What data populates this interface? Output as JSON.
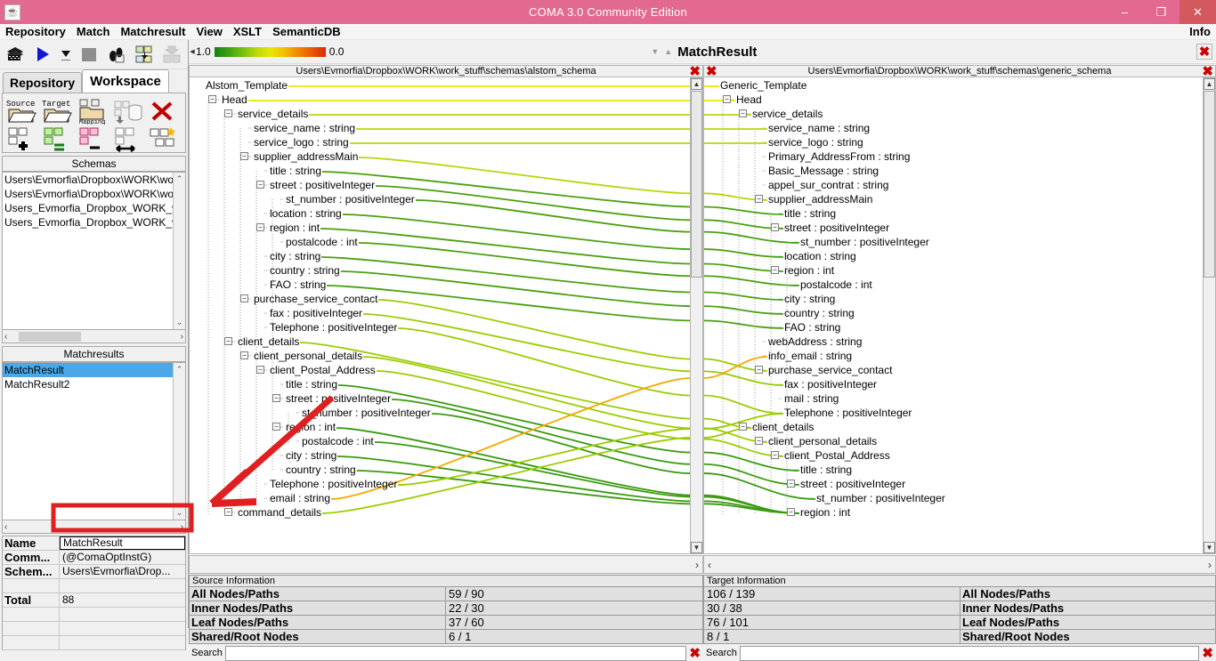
{
  "window": {
    "title": "COMA 3.0 Community Edition",
    "app_icon": "java-icon",
    "minimize": "–",
    "maximize": "❐",
    "close": "✕"
  },
  "menubar": {
    "items": [
      "Repository",
      "Match",
      "Matchresult",
      "View",
      "XSLT",
      "SemanticDB"
    ],
    "right_item": "Info"
  },
  "toolbar": {
    "icons": [
      "repository-icon",
      "run-match-icon",
      "dropdown-arrow-icon",
      "stop-icon",
      "footprint-icon",
      "import-schema-icon",
      "export-icon"
    ]
  },
  "tabs": {
    "items": [
      {
        "label": "Repository",
        "active": false
      },
      {
        "label": "Workspace",
        "active": true
      }
    ]
  },
  "workspace_tools": {
    "row1": [
      "source-folder-icon",
      "target-folder-icon",
      "mapping-folder-icon",
      "schema-to-db-icon",
      "delete-red-x-icon"
    ],
    "row1_labels": [
      "Source",
      "Target",
      "Mapping"
    ],
    "row2": [
      "add-schema-icon",
      "match-equal-icon",
      "diff-schema-icon",
      "compare-schemas-icon",
      "new-mapping-icon"
    ]
  },
  "schemas_panel": {
    "title": "Schemas",
    "items": [
      "Users\\Evmorfia\\Dropbox\\WORK\\work_",
      "Users\\Evmorfia\\Dropbox\\WORK\\work_",
      "Users_Evmorfia_Dropbox_WORK_wor",
      "Users_Evmorfia_Dropbox_WORK_wor"
    ],
    "scroll_up": "⌃",
    "scroll_down": "⌄",
    "h_left": "‹",
    "h_right": "›"
  },
  "matchresults_panel": {
    "title": "Matchresults",
    "items": [
      {
        "label": "MatchResult",
        "selected": true
      },
      {
        "label": "MatchResult2",
        "selected": false
      }
    ],
    "scroll_up": "⌃",
    "scroll_down": "⌄",
    "h_left": "‹",
    "h_right": "›"
  },
  "properties": {
    "rows": [
      {
        "key": "Name",
        "value": "MatchResult",
        "editing": true
      },
      {
        "key": "Comm...",
        "value": "(@ComaOptInstG)",
        "editing": false
      },
      {
        "key": "Schem...",
        "value": "Users\\Evmorfia\\Drop...",
        "editing": false
      },
      {
        "key": "",
        "value": "",
        "editing": false
      },
      {
        "key": "Total",
        "value": "88",
        "editing": false
      },
      {
        "key": "",
        "value": "",
        "editing": false
      },
      {
        "key": "",
        "value": "",
        "editing": false
      },
      {
        "key": "",
        "value": "",
        "editing": false
      }
    ]
  },
  "gradient": {
    "max_label": "1.0",
    "min_label": "0.0",
    "left_arrow": "◀",
    "right_arrow": "▶"
  },
  "matchresult_header": {
    "down_triangle": "▼",
    "up_triangle": "▲",
    "label": "MatchResult",
    "close": "✖"
  },
  "source_pane": {
    "path": "Users\\Evmorfia\\Dropbox\\WORK\\work_stuff\\schemas\\alstom_schema",
    "close_icon": "✖",
    "foot_left": "",
    "foot_right": "›",
    "scroll_up": "▲",
    "scroll_down": "▼",
    "nodes": [
      {
        "label": "Alstom_Template",
        "depth": 0,
        "expander": "none"
      },
      {
        "label": "Head",
        "depth": 1,
        "expander": "minus"
      },
      {
        "label": "service_details",
        "depth": 2,
        "expander": "minus"
      },
      {
        "label": "service_name : string",
        "depth": 3,
        "expander": "leaf"
      },
      {
        "label": "service_logo : string",
        "depth": 3,
        "expander": "leaf"
      },
      {
        "label": "supplier_addressMain",
        "depth": 3,
        "expander": "minus"
      },
      {
        "label": "title : string",
        "depth": 4,
        "expander": "leaf"
      },
      {
        "label": "street : positiveInteger",
        "depth": 4,
        "expander": "minus"
      },
      {
        "label": "st_number : positiveInteger",
        "depth": 5,
        "expander": "leaf"
      },
      {
        "label": "location : string",
        "depth": 4,
        "expander": "leaf"
      },
      {
        "label": "region : int",
        "depth": 4,
        "expander": "minus"
      },
      {
        "label": "postalcode : int",
        "depth": 5,
        "expander": "leaf"
      },
      {
        "label": "city : string",
        "depth": 4,
        "expander": "leaf"
      },
      {
        "label": "country : string",
        "depth": 4,
        "expander": "leaf"
      },
      {
        "label": "FAO : string",
        "depth": 4,
        "expander": "leaf"
      },
      {
        "label": "purchase_service_contact",
        "depth": 3,
        "expander": "minus"
      },
      {
        "label": "fax : positiveInteger",
        "depth": 4,
        "expander": "leaf"
      },
      {
        "label": "Telephone : positiveInteger",
        "depth": 4,
        "expander": "leaf"
      },
      {
        "label": "client_details",
        "depth": 2,
        "expander": "minus"
      },
      {
        "label": "client_personal_details",
        "depth": 3,
        "expander": "minus"
      },
      {
        "label": "client_Postal_Address",
        "depth": 4,
        "expander": "minus"
      },
      {
        "label": "title : string",
        "depth": 5,
        "expander": "leaf"
      },
      {
        "label": "street : positiveInteger",
        "depth": 5,
        "expander": "minus"
      },
      {
        "label": "st_number : positiveInteger",
        "depth": 6,
        "expander": "leaf"
      },
      {
        "label": "region : int",
        "depth": 5,
        "expander": "minus"
      },
      {
        "label": "postalcode : int",
        "depth": 6,
        "expander": "leaf"
      },
      {
        "label": "city : string",
        "depth": 5,
        "expander": "leaf"
      },
      {
        "label": "country : string",
        "depth": 5,
        "expander": "leaf"
      },
      {
        "label": "Telephone : positiveInteger",
        "depth": 4,
        "expander": "leaf"
      },
      {
        "label": "email : string",
        "depth": 4,
        "expander": "leaf"
      },
      {
        "label": "command_details",
        "depth": 2,
        "expander": "minus"
      }
    ]
  },
  "target_pane": {
    "path": "Users\\Evmorfia\\Dropbox\\WORK\\work_stuff\\schemas\\generic_schema",
    "close_icon": "✖",
    "foot_left": "‹",
    "foot_right": "›",
    "scroll_up": "▲",
    "scroll_down": "▼",
    "nodes": [
      {
        "label": "Generic_Template",
        "depth": 0,
        "expander": "none"
      },
      {
        "label": "Head",
        "depth": 1,
        "expander": "minus"
      },
      {
        "label": "service_details",
        "depth": 2,
        "expander": "minus"
      },
      {
        "label": "service_name : string",
        "depth": 3,
        "expander": "leaf"
      },
      {
        "label": "service_logo : string",
        "depth": 3,
        "expander": "leaf"
      },
      {
        "label": "Primary_AddressFrom : string",
        "depth": 3,
        "expander": "leaf"
      },
      {
        "label": "Basic_Message : string",
        "depth": 3,
        "expander": "leaf"
      },
      {
        "label": "appel_sur_contrat : string",
        "depth": 3,
        "expander": "leaf"
      },
      {
        "label": "supplier_addressMain",
        "depth": 3,
        "expander": "minus"
      },
      {
        "label": "title : string",
        "depth": 4,
        "expander": "leaf"
      },
      {
        "label": "street : positiveInteger",
        "depth": 4,
        "expander": "minus"
      },
      {
        "label": "st_number : positiveInteger",
        "depth": 5,
        "expander": "leaf"
      },
      {
        "label": "location : string",
        "depth": 4,
        "expander": "leaf"
      },
      {
        "label": "region : int",
        "depth": 4,
        "expander": "minus"
      },
      {
        "label": "postalcode : int",
        "depth": 5,
        "expander": "leaf"
      },
      {
        "label": "city : string",
        "depth": 4,
        "expander": "leaf"
      },
      {
        "label": "country : string",
        "depth": 4,
        "expander": "leaf"
      },
      {
        "label": "FAO : string",
        "depth": 4,
        "expander": "leaf"
      },
      {
        "label": "webAddress : string",
        "depth": 3,
        "expander": "leaf"
      },
      {
        "label": "info_email : string",
        "depth": 3,
        "expander": "leaf"
      },
      {
        "label": "purchase_service_contact",
        "depth": 3,
        "expander": "minus"
      },
      {
        "label": "fax : positiveInteger",
        "depth": 4,
        "expander": "leaf"
      },
      {
        "label": "mail : string",
        "depth": 4,
        "expander": "leaf"
      },
      {
        "label": "Telephone : positiveInteger",
        "depth": 4,
        "expander": "leaf"
      },
      {
        "label": "client_details",
        "depth": 2,
        "expander": "minus"
      },
      {
        "label": "client_personal_details",
        "depth": 3,
        "expander": "minus"
      },
      {
        "label": "client_Postal_Address",
        "depth": 4,
        "expander": "minus"
      },
      {
        "label": "title : string",
        "depth": 5,
        "expander": "leaf"
      },
      {
        "label": "street : positiveInteger",
        "depth": 5,
        "expander": "minus"
      },
      {
        "label": "st_number : positiveInteger",
        "depth": 6,
        "expander": "leaf"
      },
      {
        "label": "region : int",
        "depth": 5,
        "expander": "minus"
      }
    ]
  },
  "source_information": {
    "title": "Source Information",
    "rows": [
      {
        "label": "All Nodes/Paths",
        "value": "59 / 90"
      },
      {
        "label": "Inner Nodes/Paths",
        "value": "22 / 30"
      },
      {
        "label": "Leaf Nodes/Paths",
        "value": "37 / 60"
      },
      {
        "label": "Shared/Root Nodes",
        "value": "6 / 1"
      }
    ],
    "search_label": "Search",
    "search_value": "",
    "search_clear": "✖"
  },
  "target_information": {
    "title": "Target Information",
    "rows": [
      {
        "value": "106 / 139",
        "label": "All Nodes/Paths"
      },
      {
        "value": "30 / 38",
        "label": "Inner Nodes/Paths"
      },
      {
        "value": "76 / 101",
        "label": "Leaf Nodes/Paths"
      },
      {
        "value": "8 / 1",
        "label": "Shared/Root Nodes"
      }
    ],
    "search_label": "Search",
    "search_value": "",
    "search_clear": "✖"
  },
  "annotation": {
    "arrow_color": "#e02020",
    "box_color": "#e02020",
    "points_to": "Name field with value MatchResult"
  },
  "colors": {
    "titlebar": "#e2698f",
    "close_button": "#d4595f",
    "selection": "#4aa8e8",
    "panel": "#f0f0f0",
    "mapping_high": "#128012",
    "mapping_mid": "#9acd00",
    "mapping_low": "#f5a800"
  },
  "mapping_links": {
    "description": "curved links between source and target tree nodes colored by similarity",
    "links": [
      {
        "from": 0,
        "to": 0,
        "color": "#e8e800"
      },
      {
        "from": 1,
        "to": 1,
        "color": "#e8e800"
      },
      {
        "from": 2,
        "to": 2,
        "color": "#b8d60a"
      },
      {
        "from": 3,
        "to": 3,
        "color": "#b8d60a"
      },
      {
        "from": 4,
        "to": 4,
        "color": "#b8d60a"
      },
      {
        "from": 5,
        "to": 8,
        "color": "#b8d60a"
      },
      {
        "from": 6,
        "to": 9,
        "color": "#4aa010"
      },
      {
        "from": 7,
        "to": 10,
        "color": "#4aa010"
      },
      {
        "from": 8,
        "to": 11,
        "color": "#4aa010"
      },
      {
        "from": 9,
        "to": 12,
        "color": "#4aa010"
      },
      {
        "from": 10,
        "to": 13,
        "color": "#4aa010"
      },
      {
        "from": 11,
        "to": 14,
        "color": "#4aa010"
      },
      {
        "from": 12,
        "to": 15,
        "color": "#4aa010"
      },
      {
        "from": 13,
        "to": 16,
        "color": "#4aa010"
      },
      {
        "from": 14,
        "to": 17,
        "color": "#4aa010"
      },
      {
        "from": 15,
        "to": 20,
        "color": "#9acd00"
      },
      {
        "from": 16,
        "to": 21,
        "color": "#9acd00"
      },
      {
        "from": 17,
        "to": 23,
        "color": "#9acd00"
      },
      {
        "from": 18,
        "to": 24,
        "color": "#9acd00"
      },
      {
        "from": 19,
        "to": 25,
        "color": "#9acd00"
      },
      {
        "from": 20,
        "to": 26,
        "color": "#9acd00"
      },
      {
        "from": 21,
        "to": 27,
        "color": "#3a9a10"
      },
      {
        "from": 22,
        "to": 28,
        "color": "#3a9a10"
      },
      {
        "from": 23,
        "to": 29,
        "color": "#3a9a10"
      },
      {
        "from": 24,
        "to": 30,
        "color": "#3a9a10"
      },
      {
        "from": 25,
        "to": 30,
        "color": "#3a9a10"
      },
      {
        "from": 26,
        "to": 30,
        "color": "#3a9a10"
      },
      {
        "from": 27,
        "to": 30,
        "color": "#3a9a10"
      },
      {
        "from": 28,
        "to": 23,
        "color": "#9acd00"
      },
      {
        "from": 29,
        "to": 19,
        "color": "#f5a800"
      },
      {
        "from": 30,
        "to": 24,
        "color": "#9acd00"
      }
    ]
  }
}
